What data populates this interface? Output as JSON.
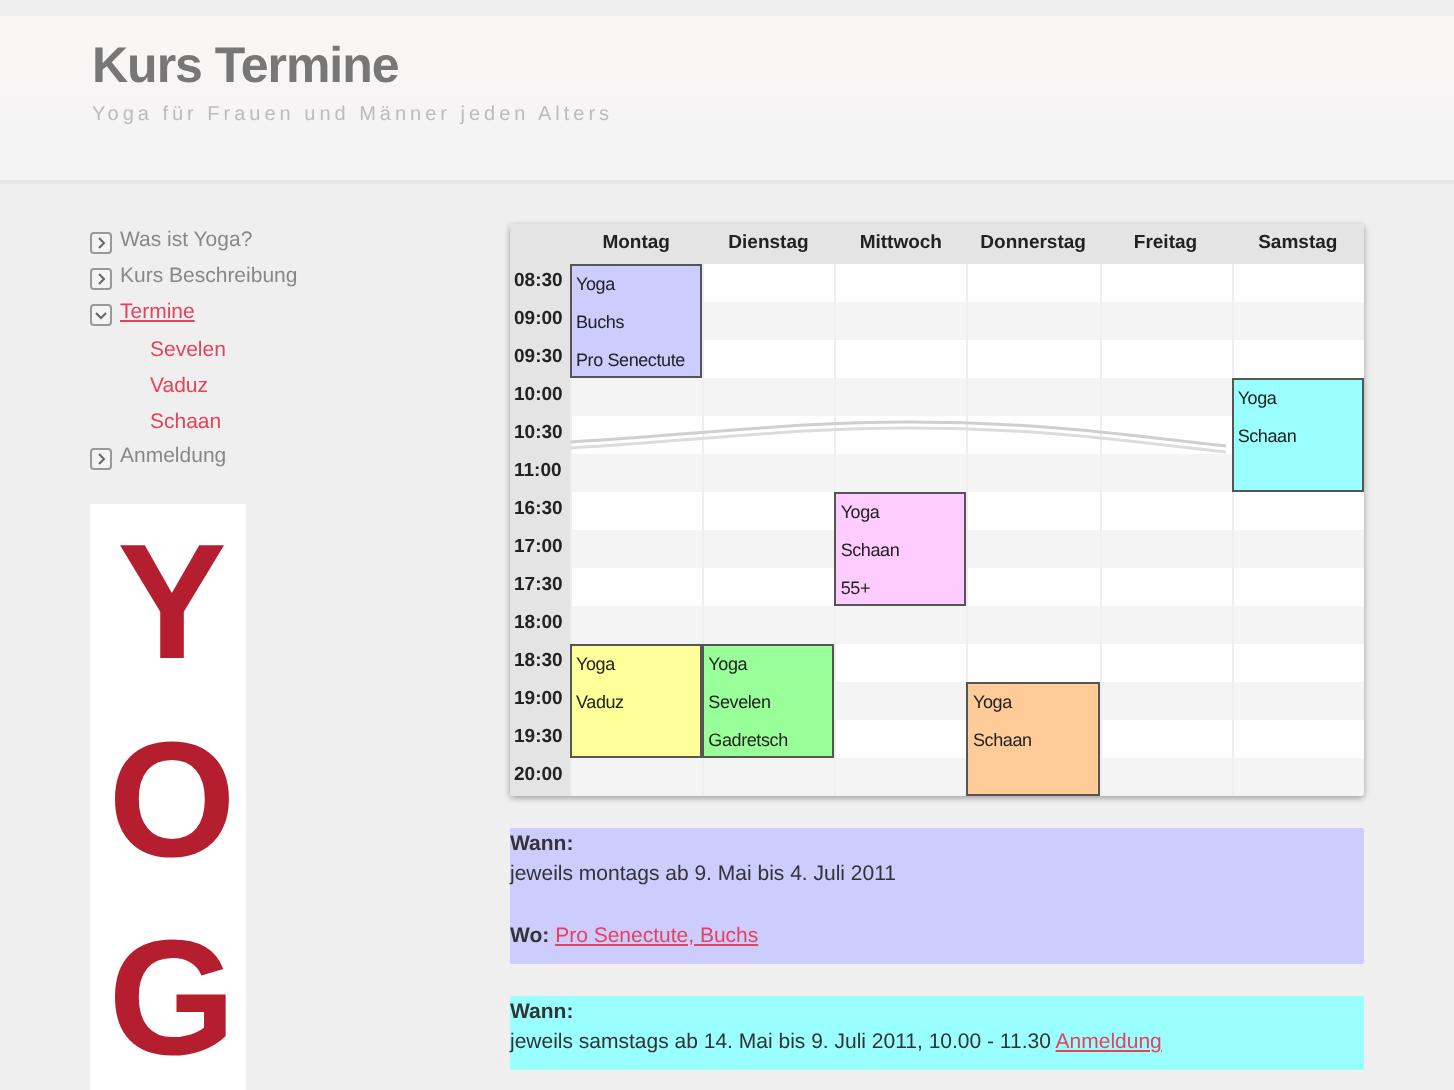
{
  "header": {
    "title": "Kurs Termine",
    "subtitle": "Yoga für Frauen und Männer jeden Alters"
  },
  "nav": [
    {
      "label": "Was ist Yoga?",
      "expanded": false,
      "selected": false
    },
    {
      "label": "Kurs Beschreibung",
      "expanded": false,
      "selected": false
    },
    {
      "label": "Termine",
      "expanded": true,
      "selected": true,
      "children": [
        {
          "label": "Sevelen"
        },
        {
          "label": "Vaduz"
        },
        {
          "label": "Schaan"
        }
      ]
    },
    {
      "label": "Anmeldung",
      "expanded": false,
      "selected": false
    }
  ],
  "logo": {
    "text": "YOG"
  },
  "schedule": {
    "days": [
      "Montag",
      "Dienstag",
      "Mittwoch",
      "Donnerstag",
      "Freitag",
      "Samstag"
    ],
    "rows": [
      {
        "time": "08:30",
        "cells": [
          {
            "kind": "event",
            "color": "#ccccff",
            "text": "Yoga"
          },
          {
            "kind": "free"
          },
          {
            "kind": "free"
          },
          {
            "kind": "free"
          },
          {
            "kind": "free"
          },
          {
            "kind": "free"
          }
        ]
      },
      {
        "time": "09:00",
        "cells": [
          {
            "kind": "event",
            "color": "#ccccff",
            "text": "Buchs"
          },
          {
            "kind": "free"
          },
          {
            "kind": "free"
          },
          {
            "kind": "free"
          },
          {
            "kind": "free"
          },
          {
            "kind": "free"
          }
        ]
      },
      {
        "time": "09:30",
        "cells": [
          {
            "kind": "event",
            "color": "#ccccff",
            "text": "Pro Senectute"
          },
          {
            "kind": "free"
          },
          {
            "kind": "free"
          },
          {
            "kind": "free"
          },
          {
            "kind": "free"
          },
          {
            "kind": "free"
          }
        ]
      },
      {
        "time": "10:00",
        "cells": [
          {
            "kind": "free"
          },
          {
            "kind": "free"
          },
          {
            "kind": "free"
          },
          {
            "kind": "free"
          },
          {
            "kind": "free"
          },
          {
            "kind": "event",
            "color": "#99ffff",
            "text": "Yoga"
          }
        ]
      },
      {
        "time": "10:30",
        "cells": [
          {
            "kind": "free"
          },
          {
            "kind": "free"
          },
          {
            "kind": "free"
          },
          {
            "kind": "free"
          },
          {
            "kind": "free"
          },
          {
            "kind": "event",
            "color": "#99ffff",
            "text": "Schaan"
          }
        ]
      },
      {
        "time": "11:00",
        "cells": [
          {
            "kind": "free"
          },
          {
            "kind": "free"
          },
          {
            "kind": "free"
          },
          {
            "kind": "free"
          },
          {
            "kind": "free"
          },
          {
            "kind": "event",
            "color": "#99ffff"
          }
        ]
      },
      {
        "time": "16:30",
        "cells": [
          {
            "kind": "free"
          },
          {
            "kind": "free"
          },
          {
            "kind": "event",
            "color": "#ffccff",
            "text": "Yoga"
          },
          {
            "kind": "free"
          },
          {
            "kind": "free"
          },
          {
            "kind": "free"
          }
        ]
      },
      {
        "time": "17:00",
        "cells": [
          {
            "kind": "free"
          },
          {
            "kind": "free"
          },
          {
            "kind": "event",
            "color": "#ffccff",
            "text": "Schaan"
          },
          {
            "kind": "free"
          },
          {
            "kind": "free"
          },
          {
            "kind": "free"
          }
        ]
      },
      {
        "time": "17:30",
        "cells": [
          {
            "kind": "free"
          },
          {
            "kind": "free"
          },
          {
            "kind": "event",
            "color": "#ffccff",
            "text": "55+"
          },
          {
            "kind": "free"
          },
          {
            "kind": "free"
          },
          {
            "kind": "free"
          }
        ]
      },
      {
        "time": "18:00",
        "cells": [
          {
            "kind": "free"
          },
          {
            "kind": "free"
          },
          {
            "kind": "free"
          },
          {
            "kind": "free"
          },
          {
            "kind": "free"
          },
          {
            "kind": "free"
          }
        ]
      },
      {
        "time": "18:30",
        "cells": [
          {
            "kind": "event",
            "color": "#ffff99",
            "text": "Yoga"
          },
          {
            "kind": "event",
            "color": "#99ff99",
            "text": "Yoga"
          },
          {
            "kind": "free"
          },
          {
            "kind": "free"
          },
          {
            "kind": "free"
          },
          {
            "kind": "free"
          }
        ]
      },
      {
        "time": "19:00",
        "cells": [
          {
            "kind": "event",
            "color": "#ffff99",
            "text": "Vaduz"
          },
          {
            "kind": "event",
            "color": "#99ff99",
            "text": "Sevelen"
          },
          {
            "kind": "free"
          },
          {
            "kind": "event",
            "color": "#ffcc99",
            "text": "Yoga"
          },
          {
            "kind": "free"
          },
          {
            "kind": "free"
          }
        ]
      },
      {
        "time": "19:30",
        "cells": [
          {
            "kind": "event",
            "color": "#ffff99"
          },
          {
            "kind": "event",
            "color": "#99ff99",
            "text": "Gadretsch"
          },
          {
            "kind": "free"
          },
          {
            "kind": "event",
            "color": "#ffcc99",
            "text": "Schaan"
          },
          {
            "kind": "free"
          },
          {
            "kind": "free"
          }
        ]
      },
      {
        "time": "20:00",
        "cells": [
          {
            "kind": "free"
          },
          {
            "kind": "free"
          },
          {
            "kind": "free"
          },
          {
            "kind": "event",
            "color": "#ffcc99"
          },
          {
            "kind": "free"
          },
          {
            "kind": "free"
          }
        ]
      }
    ]
  },
  "info": [
    {
      "color": "#ccccff",
      "when_label": "Wann:",
      "when": "jeweils montags ab 9. Mai bis 4. Juli 2011",
      "where_label": "Wo:",
      "where_link": "Pro Senectute, Buchs"
    },
    {
      "color": "#99ffff",
      "when_label": "Wann:",
      "when": "jeweils samstags ab 14. Mai bis 9. Juli 2011, 10.00 - 11.30",
      "when_link": "Anmeldung"
    }
  ]
}
